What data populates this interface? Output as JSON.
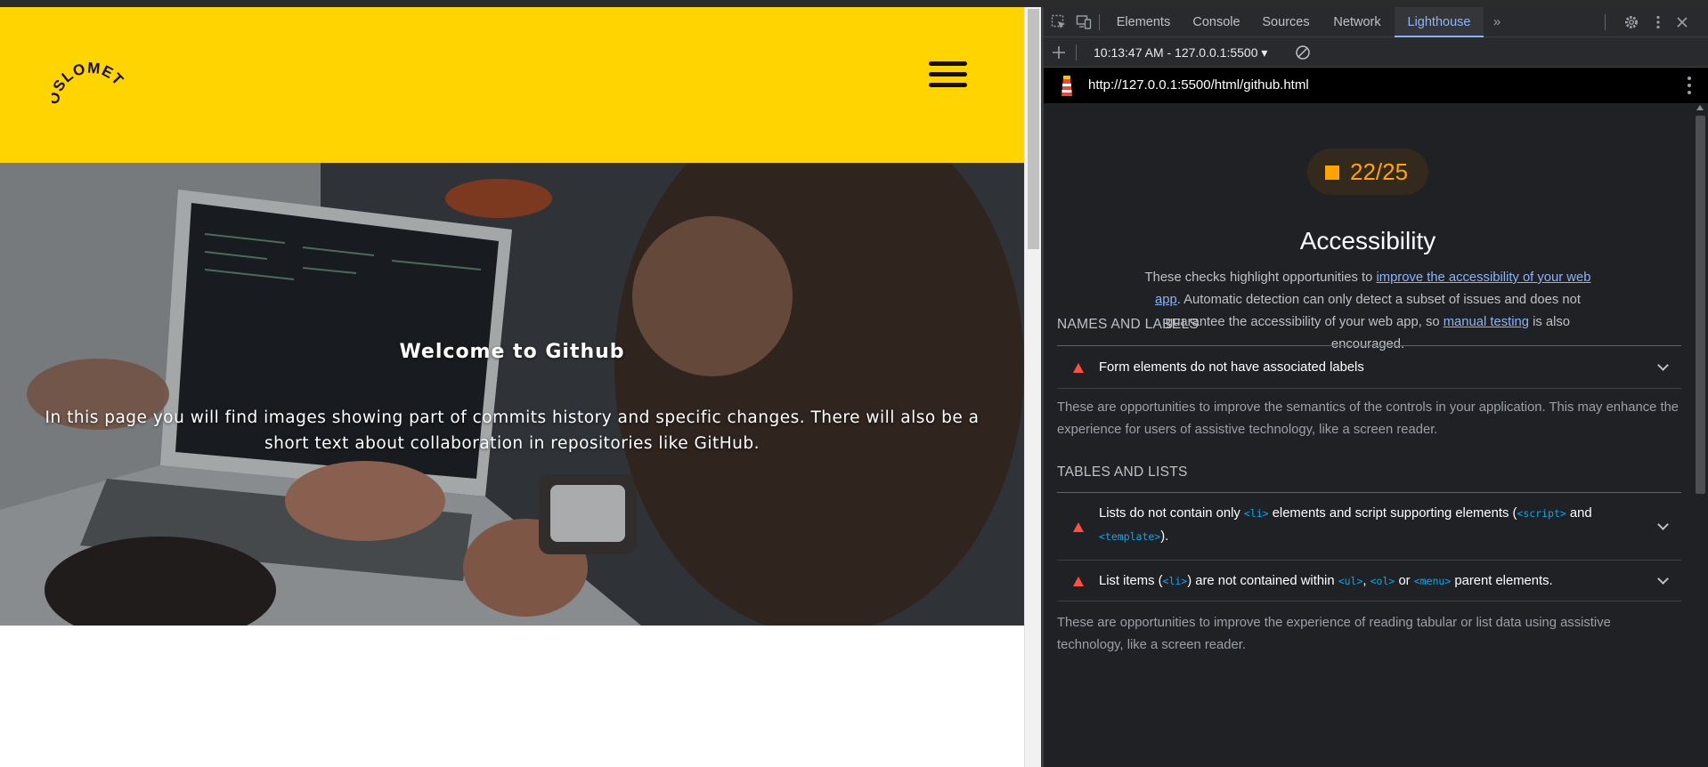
{
  "site": {
    "logo_text": "OSLOMET",
    "hero_title": "Welcome to Github",
    "hero_text": "In this page you will find images showing part of commits history and specific changes. There will also be a short text about collaboration in repositories like GitHub."
  },
  "devtools": {
    "tabs": [
      "Elements",
      "Console",
      "Sources",
      "Network",
      "Lighthouse"
    ],
    "active_tab": "Lighthouse",
    "report_selector": "10:13:47 AM - 127.0.0.1:5500 ▾",
    "url": "http://127.0.0.1:5500/html/github.html"
  },
  "lighthouse": {
    "score": "22/25",
    "score_color": "#ffa400",
    "category_title": "Accessibility",
    "desc_1": "These checks highlight opportunities to ",
    "desc_link_1": "improve the accessibility of your web app",
    "desc_2": ". Automatic detection can only detect a subset of issues and does not guarantee the accessibility of your web app, so ",
    "desc_link_2": "manual testing",
    "desc_3": " is also encouraged.",
    "groups": [
      {
        "title": "NAMES AND LABELS",
        "audit_1": "Form elements do not have associated labels",
        "desc": "These are opportunities to improve the semantics of the controls in your application. This may enhance the experience for users of assistive technology, like a screen reader."
      },
      {
        "title": "TABLES AND LISTS",
        "audit_1_a": "Lists do not contain only ",
        "audit_1_code_1": "<li>",
        "audit_1_b": " elements and script supporting elements (",
        "audit_1_code_2": "<script>",
        "audit_1_c": " and ",
        "audit_1_code_3": "<template>",
        "audit_1_d": ").",
        "audit_2_a": "List items (",
        "audit_2_code_1": "<li>",
        "audit_2_b": ") are not contained within ",
        "audit_2_code_2": "<ul>",
        "audit_2_c": ", ",
        "audit_2_code_3": "<ol>",
        "audit_2_d": " or ",
        "audit_2_code_4": "<menu>",
        "audit_2_e": " parent elements.",
        "desc": "These are opportunities to improve the experience of reading tabular or list data using assistive technology, like a screen reader."
      }
    ]
  }
}
